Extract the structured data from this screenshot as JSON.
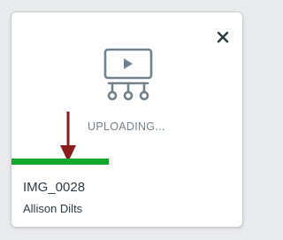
{
  "upload_card": {
    "status_text": "UPLOADING...",
    "title": "IMG_0028",
    "author": "Allison Dilts",
    "progress": 0.42,
    "icons": {
      "close": "close-x-icon",
      "media": "video-tile-icon",
      "annotation": "red-down-arrow"
    },
    "colors": {
      "progress": "#13a82d",
      "arrow": "#8b1c1c",
      "status_text": "#73818c",
      "text": "#2d3b45",
      "icon": "#73818c",
      "close": "#2d3b45"
    }
  }
}
